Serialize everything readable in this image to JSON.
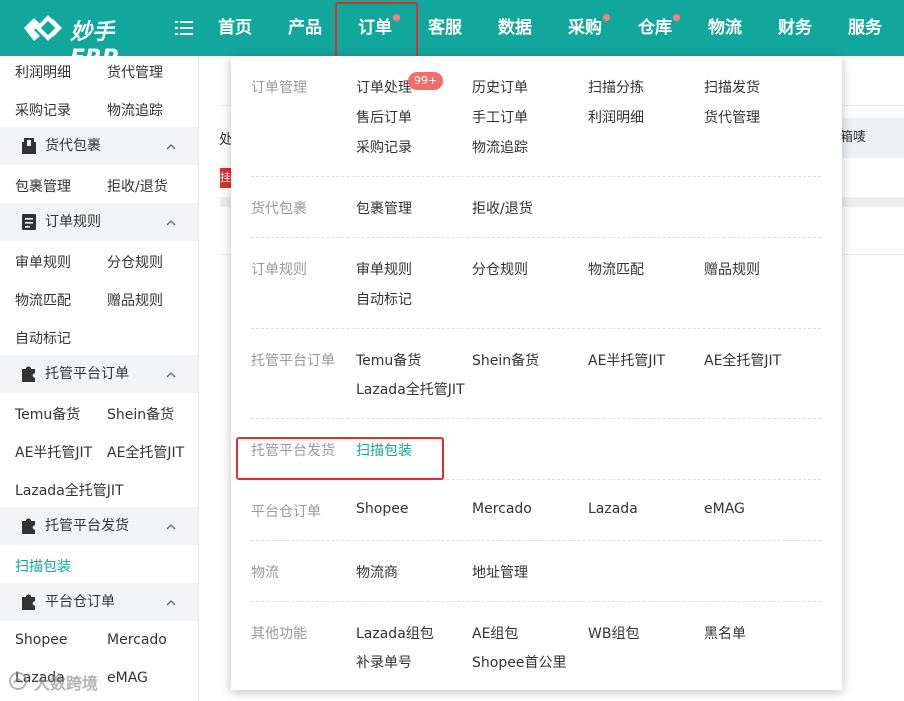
{
  "brand": {
    "name": "妙手ERP",
    "color": "#12a79d",
    "icon": "miaoshou-logo-icon"
  },
  "nav": [
    {
      "label": "首页"
    },
    {
      "label": "产品"
    },
    {
      "label": "订单",
      "dot": true,
      "active": true
    },
    {
      "label": "客服"
    },
    {
      "label": "数据"
    },
    {
      "label": "采购",
      "dot": true
    },
    {
      "label": "仓库",
      "dot": true
    },
    {
      "label": "物流"
    },
    {
      "label": "财务"
    },
    {
      "label": "服务"
    }
  ],
  "sidebar": {
    "top_links": [
      "利润明细",
      "货代管理",
      "采购记录",
      "物流追踪"
    ],
    "groups": [
      {
        "label": "货代包裹",
        "icon": "package-icon",
        "links": [
          "包裹管理",
          "拒收/退货"
        ]
      },
      {
        "label": "订单规则",
        "icon": "rules-icon",
        "links": [
          "审单规则",
          "分仓规则",
          "物流匹配",
          "赠品规则",
          "自动标记"
        ]
      },
      {
        "label": "托管平台订单",
        "icon": "puzzle-icon",
        "links": [
          "Temu备货",
          "Shein备货",
          "AE半托管JIT",
          "AE全托管JIT",
          "Lazada全托管JIT"
        ]
      },
      {
        "label": "托管平台发货",
        "icon": "puzzle-icon",
        "links": [
          "扫描包装"
        ],
        "active_link": "扫描包装"
      },
      {
        "label": "平台仓订单",
        "icon": "puzzle-icon",
        "links": [
          "Shopee",
          "Mercado",
          "Lazada",
          "eMAG"
        ]
      }
    ]
  },
  "background": {
    "right_text": "箱唛",
    "left_char": "处",
    "left_mark": "挂"
  },
  "dropdown": {
    "sections": [
      {
        "title": "订单管理",
        "items": [
          "订单处理",
          "历史订单",
          "扫描分拣",
          "扫描发货",
          "售后订单",
          "手工订单",
          "利润明细",
          "货代管理",
          "采购记录",
          "物流追踪"
        ],
        "badge": "99+"
      },
      {
        "title": "货代包裹",
        "items": [
          "包裹管理",
          "拒收/退货"
        ]
      },
      {
        "title": "订单规则",
        "items": [
          "审单规则",
          "分仓规则",
          "物流匹配",
          "赠品规则",
          "自动标记"
        ]
      },
      {
        "title": "托管平台订单",
        "items": [
          "Temu备货",
          "Shein备货",
          "AE半托管JIT",
          "AE全托管JIT",
          "Lazada全托管JIT"
        ]
      },
      {
        "title": "托管平台发货",
        "items": [
          "扫描包装"
        ],
        "highlight": "扫描包装"
      },
      {
        "title": "平台仓订单",
        "items": [
          "Shopee",
          "Mercado",
          "Lazada",
          "eMAG"
        ]
      },
      {
        "title": "物流",
        "items": [
          "物流商",
          "地址管理"
        ]
      },
      {
        "title": "其他功能",
        "items": [
          "Lazada组包",
          "AE组包",
          "WB组包",
          "黑名单",
          "补录单号",
          "Shopee首公里"
        ]
      }
    ]
  },
  "watermark": "大数跨境",
  "colors": {
    "accent": "#12a79d",
    "dot": "#ff7f7f",
    "badge": "#f56c6c",
    "highlight_box": "#e02d2d"
  }
}
